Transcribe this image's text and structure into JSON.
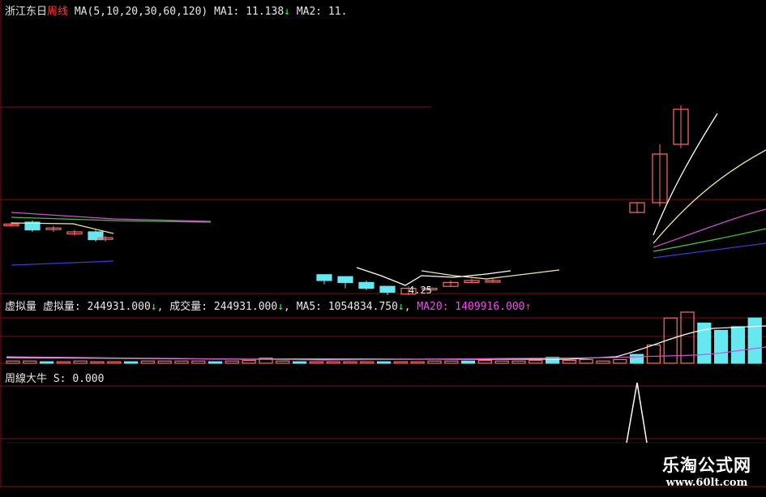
{
  "colors": {
    "background": "#000000",
    "grid": "#7a1010",
    "up": "#ff6b6b",
    "down": "#66e8f0",
    "ma1": "#ffffff",
    "ma2": "#f5e6a0",
    "ma3": "#d050d0",
    "ma4": "#40c040",
    "ma5": "#3a3ad8"
  },
  "price_panel": {
    "stock_name": "浙江东日",
    "period": "周线",
    "ma_params": "MA(5,10,20,30,60,120)",
    "ma1_label": "MA1:",
    "ma1_value": "11.138",
    "ma1_arrow": "↓",
    "ma2_label": "MA2:",
    "ma2_value": "11.",
    "low_marker": "4.25"
  },
  "volume_panel": {
    "title": "虚拟量",
    "vv_label": "虚拟量:",
    "vv_value": "244931.000",
    "vv_arrow": "↓",
    "vol_label": "成交量:",
    "vol_value": "244931.000",
    "vol_arrow": "↓",
    "ma5_label": "MA5:",
    "ma5_value": "1054834.750",
    "ma5_arrow": "↓",
    "ma20_label": "MA20:",
    "ma20_value": "1409916.000",
    "ma20_arrow": "↑"
  },
  "indicator_panel": {
    "title": "周線大牛",
    "s_label": "S:",
    "s_value": "0.000"
  },
  "watermark": {
    "title": "乐淘公式网",
    "url": "www.60lt.com"
  },
  "chart_data": {
    "type": "candlestick",
    "period": "weekly",
    "price_candles": [
      {
        "o": 7.9,
        "c": 7.9,
        "h": 8.0,
        "l": 7.8,
        "dir": "up"
      },
      {
        "o": 8.0,
        "c": 7.6,
        "h": 8.1,
        "l": 7.5,
        "dir": "down"
      },
      {
        "o": 7.7,
        "c": 7.7,
        "h": 7.8,
        "l": 7.5,
        "dir": "up"
      },
      {
        "o": 7.5,
        "c": 7.4,
        "h": 7.6,
        "l": 7.3,
        "dir": "up"
      },
      {
        "o": 7.5,
        "c": 7.1,
        "h": 7.6,
        "l": 7.0,
        "dir": "down"
      },
      {
        "o": 7.2,
        "c": 7.2,
        "h": 7.3,
        "l": 7.0,
        "dir": "up"
      },
      {
        "o": 5.3,
        "c": 5.0,
        "h": 5.3,
        "l": 4.8,
        "dir": "down"
      },
      {
        "o": 5.2,
        "c": 4.9,
        "h": 5.2,
        "l": 4.6,
        "dir": "down"
      },
      {
        "o": 4.9,
        "c": 4.6,
        "h": 5.0,
        "l": 4.5,
        "dir": "down"
      },
      {
        "o": 4.7,
        "c": 4.4,
        "h": 4.7,
        "l": 4.25,
        "dir": "down"
      },
      {
        "o": 4.3,
        "c": 4.6,
        "h": 4.7,
        "l": 4.25,
        "dir": "up"
      },
      {
        "o": 4.6,
        "c": 4.6,
        "h": 4.7,
        "l": 4.5,
        "dir": "up"
      },
      {
        "o": 4.7,
        "c": 4.9,
        "h": 5.0,
        "l": 4.7,
        "dir": "up"
      },
      {
        "o": 4.9,
        "c": 5.0,
        "h": 5.1,
        "l": 4.9,
        "dir": "up"
      },
      {
        "o": 5.0,
        "c": 5.0,
        "h": 5.1,
        "l": 4.9,
        "dir": "up"
      },
      {
        "o": 8.5,
        "c": 9.0,
        "h": 9.0,
        "l": 8.5,
        "dir": "up"
      },
      {
        "o": 9.0,
        "c": 11.5,
        "h": 12.0,
        "l": 8.8,
        "dir": "up"
      },
      {
        "o": 12.0,
        "c": 13.8,
        "h": 14.0,
        "l": 11.8,
        "dir": "up"
      }
    ],
    "volume_bars": [
      3,
      3,
      2,
      2,
      3,
      2,
      2,
      2,
      3,
      3,
      3,
      3,
      2,
      3,
      4,
      7,
      3,
      2,
      2,
      2,
      2,
      2,
      2,
      2,
      2,
      3,
      3,
      3,
      4,
      3,
      3,
      4,
      8,
      4,
      5,
      3,
      5,
      12,
      25,
      62,
      70,
      55,
      45,
      50,
      62
    ]
  }
}
